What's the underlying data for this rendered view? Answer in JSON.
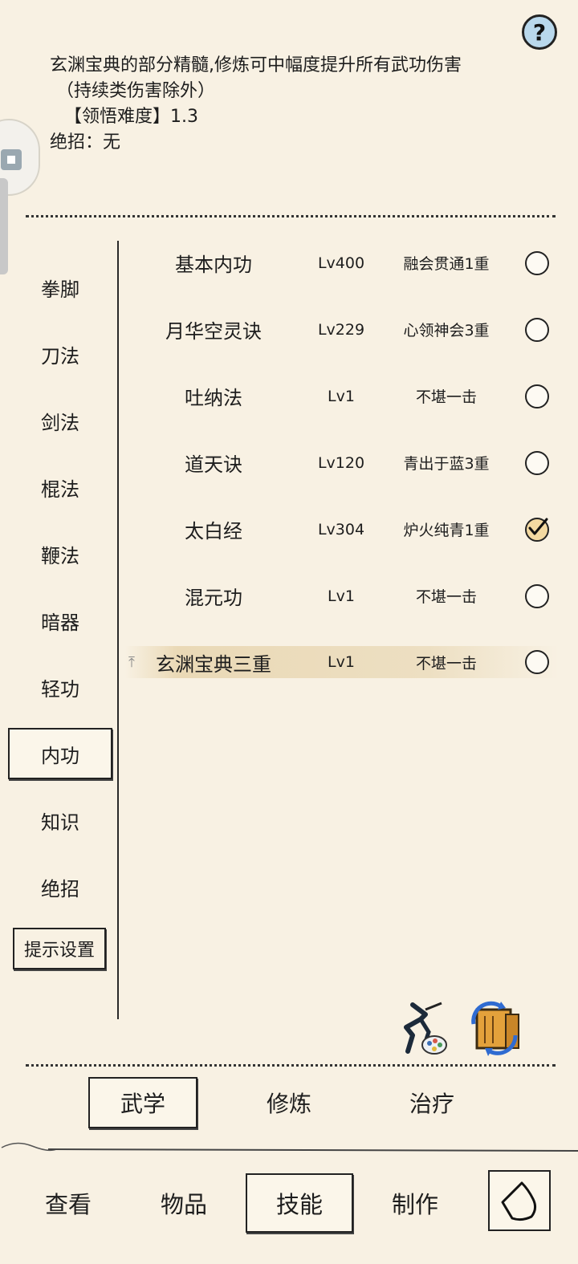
{
  "help": {
    "label": "?"
  },
  "description": {
    "line1": "玄渊宝典的部分精髓,修炼可中幅度提升所有武功伤害",
    "line2": "（持续类伤害除外）",
    "difficulty": "【领悟难度】1.3",
    "ultimate": "绝招：无"
  },
  "categories": [
    {
      "label": "拳脚"
    },
    {
      "label": "刀法"
    },
    {
      "label": "剑法"
    },
    {
      "label": "棍法"
    },
    {
      "label": "鞭法"
    },
    {
      "label": "暗器"
    },
    {
      "label": "轻功"
    },
    {
      "label": "内功"
    },
    {
      "label": "知识"
    },
    {
      "label": "绝招"
    }
  ],
  "hint_settings": "提示设置",
  "skills": [
    {
      "name": "基本内功",
      "level": "Lv400",
      "stage": "融会贯通1重",
      "checked": false
    },
    {
      "name": "月华空灵诀",
      "level": "Lv229",
      "stage": "心领神会3重",
      "checked": false
    },
    {
      "name": "吐纳法",
      "level": "Lv1",
      "stage": "不堪一击",
      "checked": false
    },
    {
      "name": "道天诀",
      "level": "Lv120",
      "stage": "青出于蓝3重",
      "checked": false
    },
    {
      "name": "太白经",
      "level": "Lv304",
      "stage": "炉火纯青1重",
      "checked": true
    },
    {
      "name": "混元功",
      "level": "Lv1",
      "stage": "不堪一击",
      "checked": false
    },
    {
      "name": "玄渊宝典三重",
      "level": "Lv1",
      "stage": "不堪一击",
      "checked": false
    }
  ],
  "tabs": [
    {
      "label": "武学"
    },
    {
      "label": "修炼"
    },
    {
      "label": "治疗"
    }
  ],
  "bottom_nav": [
    {
      "label": "查看"
    },
    {
      "label": "物品"
    },
    {
      "label": "技能"
    },
    {
      "label": "制作"
    }
  ],
  "colors": {
    "background": "#f8f1e3",
    "help_button": "#b9d8ec",
    "check_fill": "#f3d9a1",
    "highlight_row": "#eddfc2"
  }
}
